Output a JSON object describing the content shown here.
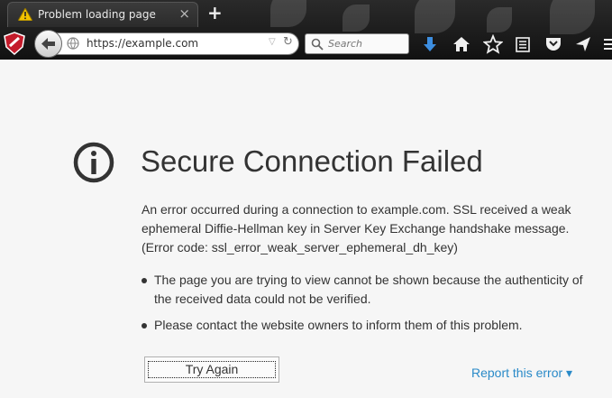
{
  "tab": {
    "title": "Problem loading page",
    "close": "×",
    "new_tab": "+"
  },
  "toolbar": {
    "url": "https://example.com",
    "search_placeholder": "Search"
  },
  "error": {
    "title": "Secure Connection Failed",
    "description_lines": [
      "An error occurred during a connection to example.com. SSL received a weak",
      "ephemeral Diffie-Hellman key in Server Key Exchange handshake message.",
      "(Error code: ssl_error_weak_server_ephemeral_dh_key)"
    ],
    "bullets": [
      "The page you are trying to view cannot be shown because the authenticity of the received data could not be verified.",
      "Please contact the website owners to inform them of this problem."
    ],
    "try_again": "Try Again",
    "report": "Report this error ▾"
  },
  "colors": {
    "link": "#2a8ac8",
    "download_arrow": "#3d8ee0"
  }
}
